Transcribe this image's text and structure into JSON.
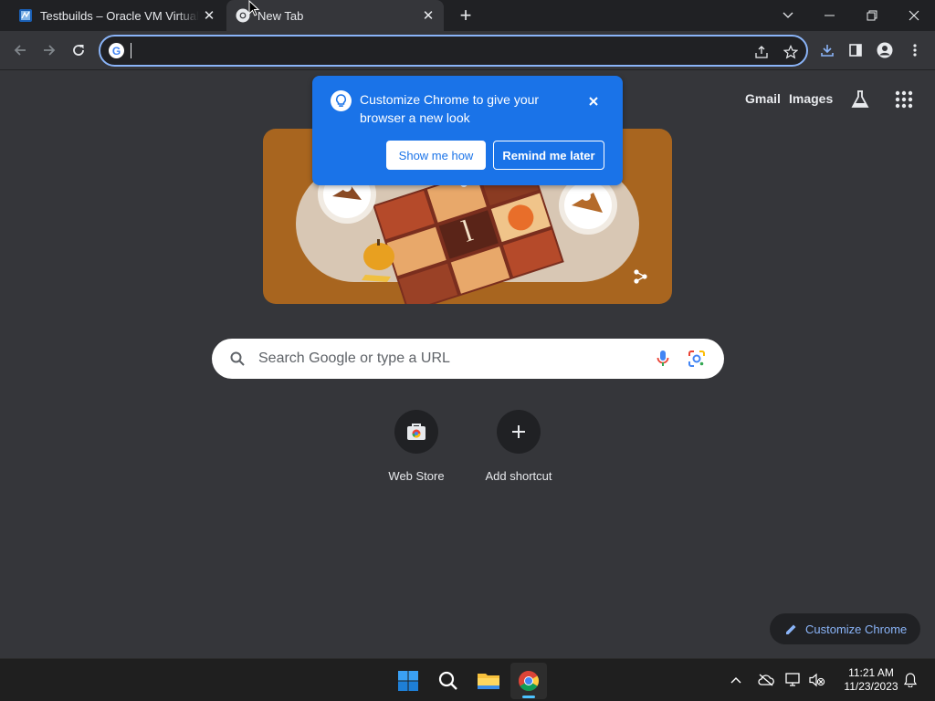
{
  "tabs": [
    {
      "title": "Testbuilds – Oracle VM VirtualBox",
      "active": false
    },
    {
      "title": "New Tab",
      "active": true
    }
  ],
  "omnibox": {
    "value": ""
  },
  "ntp": {
    "top_links": {
      "gmail": "Gmail",
      "images": "Images"
    },
    "search_placeholder": "Search Google or type a URL",
    "shortcuts": [
      {
        "label": "Web Store",
        "icon": "web-store-icon"
      },
      {
        "label": "Add shortcut",
        "icon": "plus-icon"
      }
    ],
    "customize_label": "Customize Chrome"
  },
  "bubble": {
    "text": "Customize Chrome to give your browser a new look",
    "primary": "Show me how",
    "secondary": "Remind me later"
  },
  "taskbar": {
    "apps": [
      "start-icon",
      "search-icon",
      "file-explorer-icon",
      "chrome-icon"
    ],
    "time": "11:21 AM",
    "date": "11/23/2023"
  },
  "colors": {
    "accent": "#8ab4f8",
    "bubble": "#1a73e8",
    "doodle_bg": "#a8651f",
    "page_bg": "#35363a",
    "tabstrip_bg": "#202124"
  }
}
